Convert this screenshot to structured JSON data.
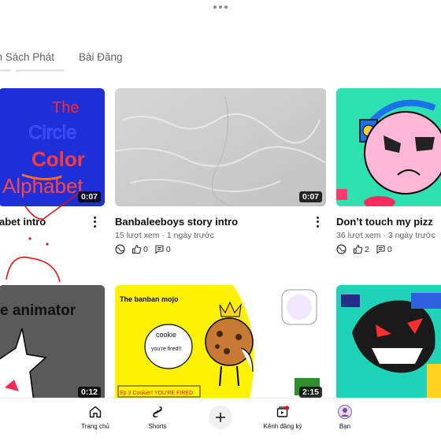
{
  "tabs": [
    "nh Sách Phát",
    "Bài Đăng"
  ],
  "videos": [
    {
      "title": "abet intro",
      "duration": "0:07",
      "thumb_text": [
        "The",
        "Circle",
        "Color",
        "Alphabet"
      ]
    },
    {
      "title": "Banbaleeboys story intro",
      "meta": "15 lượt xem · 1 ngày trước",
      "likes": "0",
      "comments": "0",
      "duration": "0:07"
    },
    {
      "title": "Don’t touch my pizz",
      "meta": "36 lượt xem · 3 ngày trước",
      "likes": "2",
      "comments": "0"
    },
    {
      "duration": "0:12",
      "thumb_text": "e animator"
    },
    {
      "duration": "2:15",
      "thumb_text": {
        "heading": "The banban mojo",
        "bubble1": "cookie",
        "bubble2": "you're fired!!",
        "caption": "Ep 3 Cookie!! YOU'RE FIRED"
      }
    },
    {}
  ],
  "nav": [
    {
      "label": "Trang chủ",
      "icon": "home-icon"
    },
    {
      "label": "Shorts",
      "icon": "shorts-icon"
    },
    {
      "label": "",
      "icon": "plus-icon"
    },
    {
      "label": "Kênh đăng ký",
      "icon": "subscriptions-icon"
    },
    {
      "label": "Bạn",
      "icon": "avatar"
    }
  ],
  "colors": {
    "thumb1_bg": "#1e2fd8",
    "thumb3_bg": "#2fe0b0",
    "thumb5_bg": "#fff200",
    "thumb6_bg": "#20d2b8",
    "notification_dot": "#ff0000"
  }
}
